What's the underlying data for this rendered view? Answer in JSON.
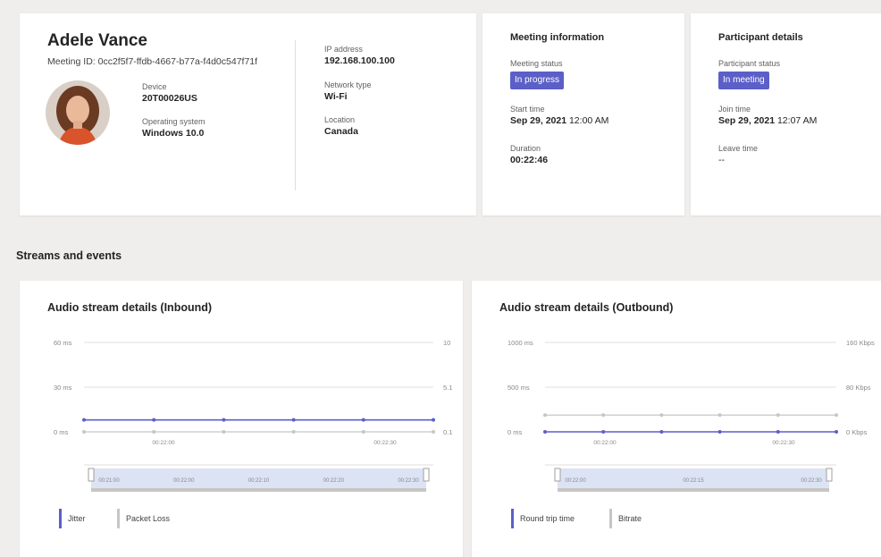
{
  "colors": {
    "accent": "#5b5fc7",
    "secondary_line": "#c8c6c4",
    "grid": "#e1dfdd",
    "axis_text": "#8a8886",
    "brush": "#dbe3f4"
  },
  "user": {
    "name": "Adele Vance",
    "meeting_id": "Meeting ID: 0cc2f5f7-ffdb-4667-b77a-f4d0c547f71f",
    "device_label": "Device",
    "device_value": "20T00026US",
    "os_label": "Operating system",
    "os_value": "Windows 10.0",
    "ip_label": "IP address",
    "ip_value": "192.168.100.100",
    "network_label": "Network type",
    "network_value": "Wi-Fi",
    "location_label": "Location",
    "location_value": "Canada"
  },
  "meeting": {
    "title": "Meeting information",
    "status_label": "Meeting status",
    "status_value": "In progress",
    "start_label": "Start time",
    "start_date": "Sep 29, 2021",
    "start_time": "12:00 AM",
    "duration_label": "Duration",
    "duration_value": "00:22:46"
  },
  "participant": {
    "title": "Participant details",
    "status_label": "Participant status",
    "status_value": "In meeting",
    "join_label": "Join time",
    "join_date": "Sep 29, 2021",
    "join_time": "12:07 AM",
    "leave_label": "Leave time",
    "leave_value": "--"
  },
  "streams": {
    "section_title": "Streams and events"
  },
  "chart_data": [
    {
      "type": "line",
      "title": "Audio stream details (Inbound)",
      "left_axis_ticks": [
        "60 ms",
        "30 ms",
        "0 ms"
      ],
      "right_axis_ticks": [
        "10",
        "5.1",
        "0.1"
      ],
      "x_tick_labels": [
        "00:22:00",
        "00:22:30"
      ],
      "brush_labels": [
        "00:21:00",
        "00:22:00",
        "00:22:10",
        "00:22:20",
        "00:22:30"
      ],
      "series": [
        {
          "name": "Jitter",
          "values": [
            8,
            8,
            8,
            8,
            8,
            8
          ]
        },
        {
          "name": "Packet Loss",
          "values": [
            0,
            0,
            0,
            0,
            0,
            0
          ]
        }
      ]
    },
    {
      "type": "line",
      "title": "Audio stream details (Outbound)",
      "left_axis_ticks": [
        "1000 ms",
        "500 ms",
        "0 ms"
      ],
      "right_axis_ticks": [
        "160 Kbps",
        "80 Kbps",
        "0 Kbps"
      ],
      "x_tick_labels": [
        "00:22:00",
        "00:22:30"
      ],
      "brush_labels": [
        "00:22:00",
        "00:22:15",
        "00:22:30"
      ],
      "series": [
        {
          "name": "Round trip time",
          "values": [
            0,
            0,
            0,
            0,
            0,
            0
          ]
        },
        {
          "name": "Bitrate",
          "values": [
            30,
            30,
            30,
            30,
            30,
            30
          ]
        }
      ]
    }
  ]
}
